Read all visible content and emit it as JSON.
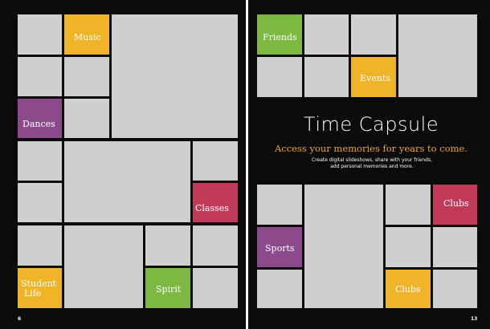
{
  "colors": {
    "background": "#0b0b0b",
    "tile_gray": "#cfcfcf",
    "gold": "#f0b428",
    "purple": "#8c4a8c",
    "crimson": "#c23a5a",
    "green": "#7db842",
    "accent_text": "#f1a51c"
  },
  "left_page": {
    "page_number": "6",
    "labels": {
      "music": "Music",
      "dances": "Dances",
      "classes": "Classes",
      "student_life_line1": "Student",
      "student_life_line2": "Life",
      "spirit": "Spirit"
    }
  },
  "right_page": {
    "page_number": "13",
    "title": "Time Capsule",
    "subtitle": "Access your memories for years to come.",
    "body_line1": "Create digital slideshows, share with your friends,",
    "body_line2": "add personal memories and more.",
    "labels": {
      "friends": "Friends",
      "events": "Events",
      "clubs_top": "Clubs",
      "sports": "Sports",
      "clubs_bottom": "Clubs"
    }
  }
}
